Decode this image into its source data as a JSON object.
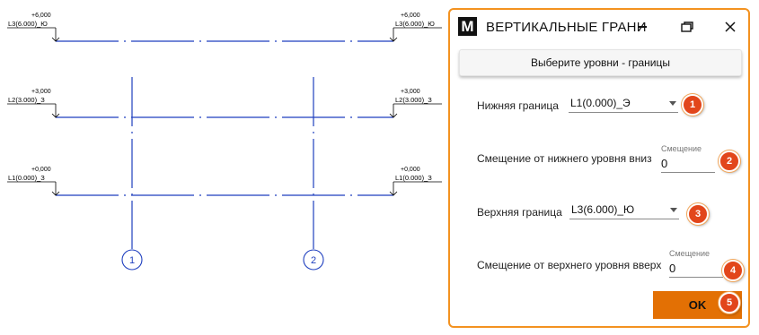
{
  "drawing": {
    "levels": [
      {
        "elevation": "+6,000",
        "name": "L3(6.000)_Ю",
        "name_right": "L3(6.000)_Ю"
      },
      {
        "elevation": "+3,000",
        "name": "L2(3.000)_З",
        "name_right": "L2(3.000)_З"
      },
      {
        "elevation": "+0,000",
        "name": "L1(0.000)_З",
        "name_right": "L1(0.000)_З"
      }
    ],
    "grids": [
      "1",
      "2"
    ],
    "line_color": "#1f3fbf"
  },
  "dialog": {
    "app_icon_letter": "M",
    "title": "ВЕРТИКАЛЬНЫЕ ГРАНИ",
    "select_button_label": "Выберите уровни - границы",
    "lower_bound": {
      "label": "Нижняя граница",
      "value": "L1(0.000)_Э"
    },
    "lower_offset": {
      "label": "Смещение от нижнего уровня вниз",
      "hint": "Смещение",
      "value": "0"
    },
    "upper_bound": {
      "label": "Верхняя граница",
      "value": "L3(6.000)_Ю"
    },
    "upper_offset": {
      "label": "Смещение от верхнего уровня вверх",
      "hint": "Смещение",
      "value": "0"
    },
    "ok_label": "OK",
    "accent_color": "#f39220",
    "ok_color": "#e37004",
    "badge_color": "#e2461b"
  },
  "badges": [
    "1",
    "2",
    "3",
    "4",
    "5"
  ]
}
